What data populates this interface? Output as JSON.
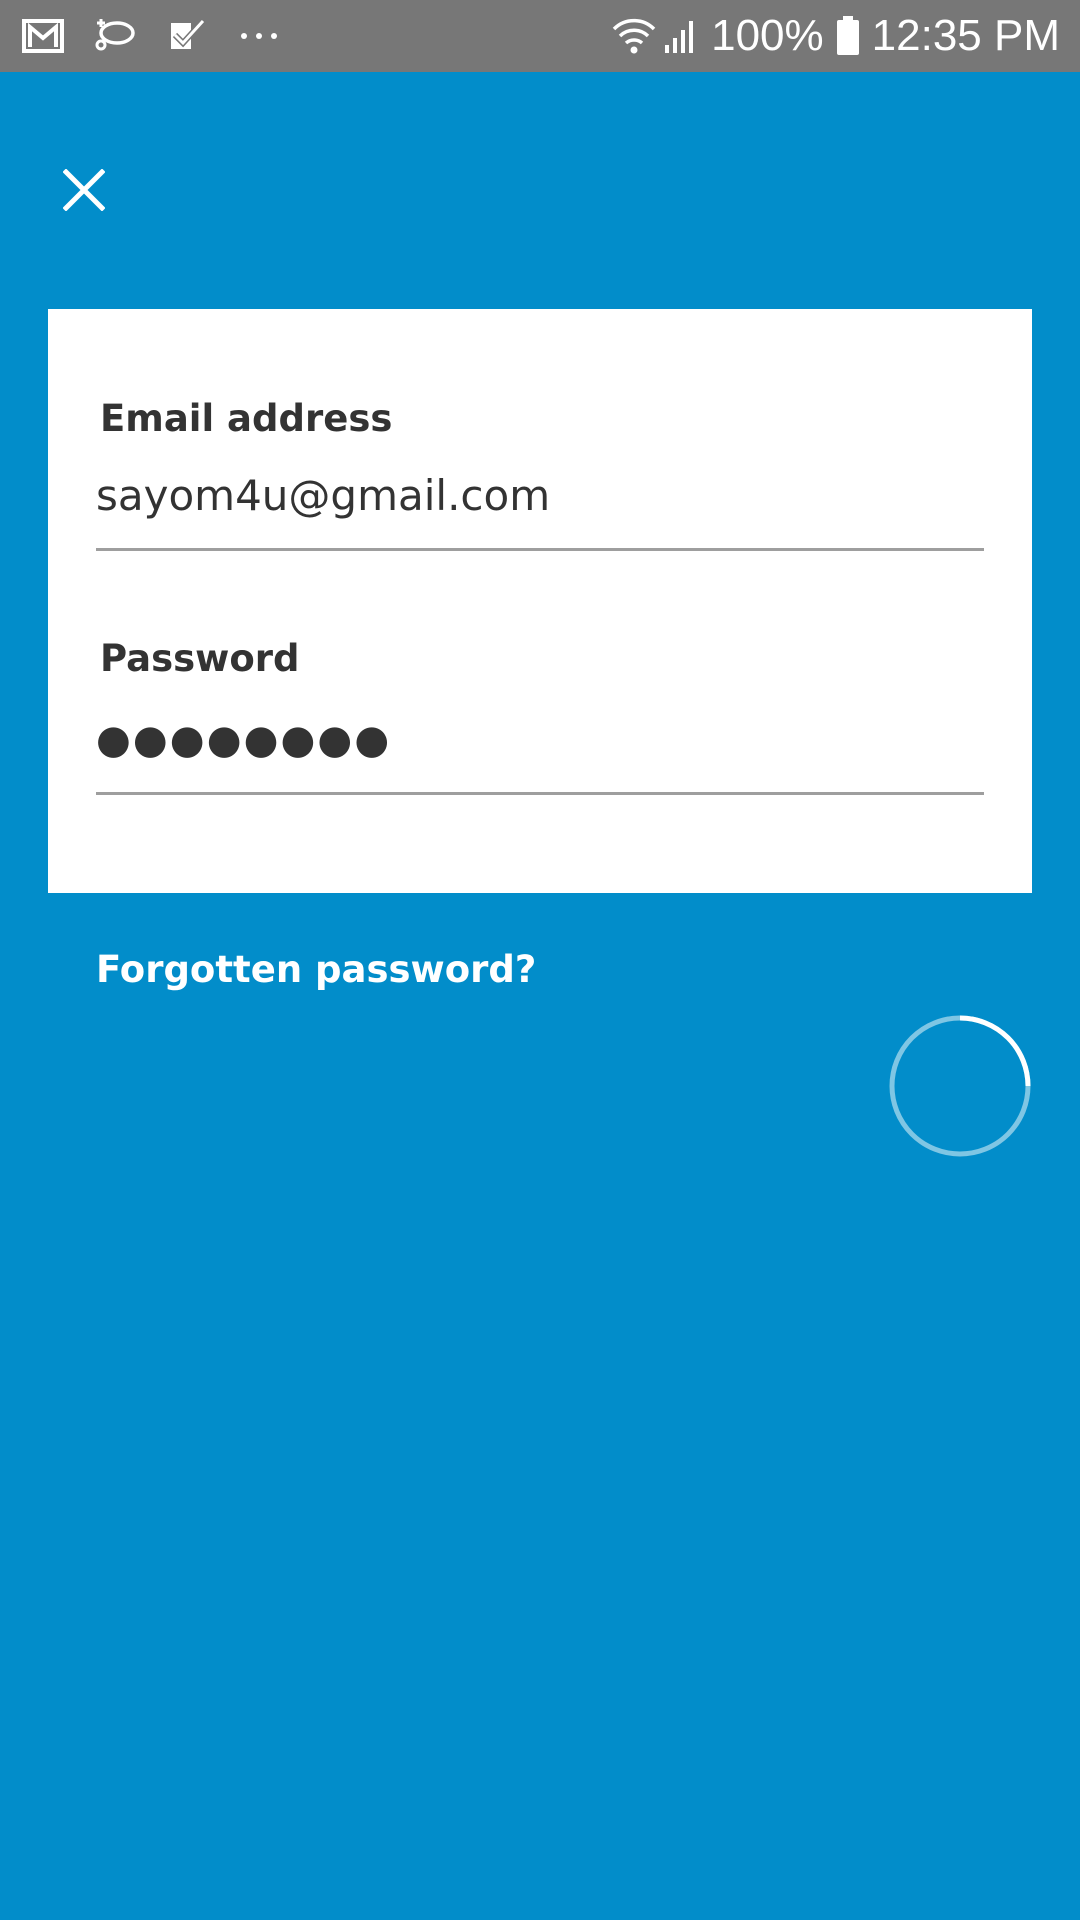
{
  "status_bar": {
    "battery": "100%",
    "time": "12:35 PM",
    "icons": [
      "gmail-icon",
      "sync-icon",
      "tasks-icon",
      "more-dots-icon",
      "wifi-icon",
      "signal-icon",
      "battery-icon"
    ]
  },
  "header": {
    "close_icon": "close-icon"
  },
  "form": {
    "email": {
      "label": "Email address",
      "value": "sayom4u@gmail.com"
    },
    "password": {
      "label": "Password",
      "value": "●●●●●●●●"
    }
  },
  "forgot_link": "Forgotten password?",
  "colors": {
    "background": "#028dca",
    "status_bar": "#777777",
    "card": "#ffffff",
    "text": "#333333"
  }
}
